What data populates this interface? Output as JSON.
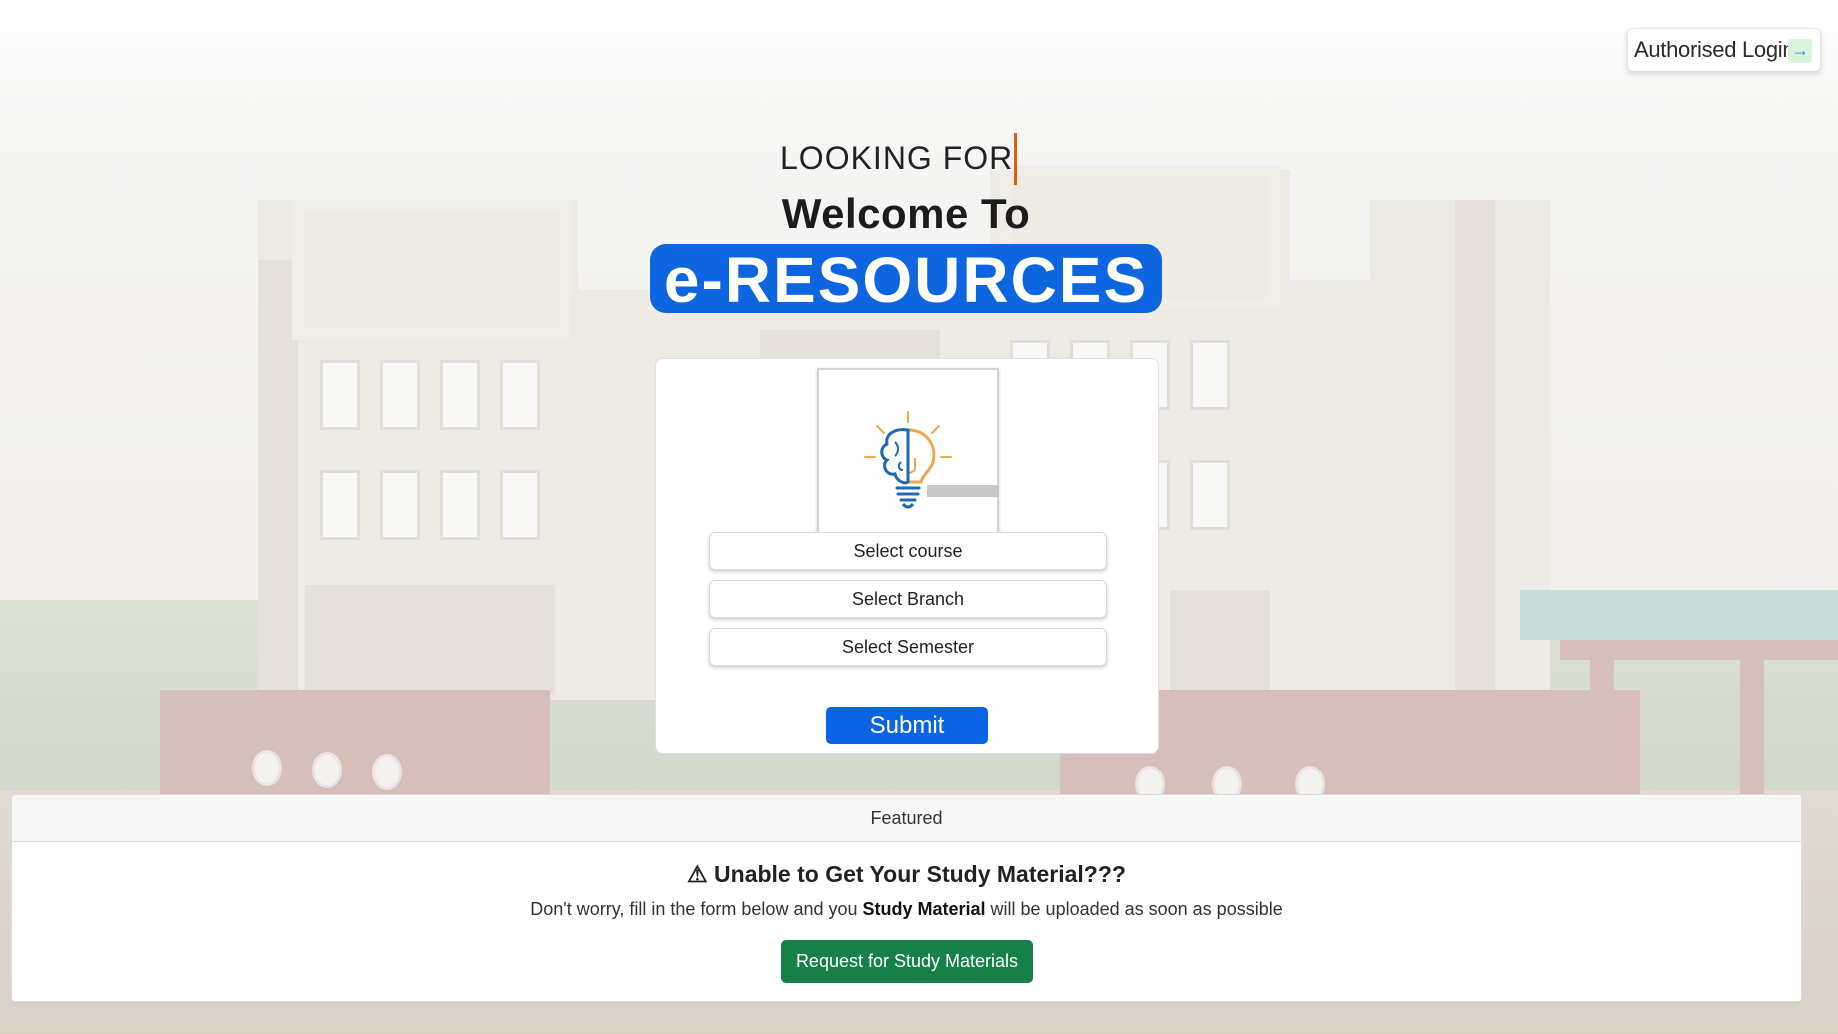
{
  "header": {
    "login_label": "Authorised Login",
    "login_icon": "login-arrow-icon"
  },
  "hero": {
    "looking_for": "LOOKING FOR",
    "welcome": "Welcome To",
    "brand": "e-RESOURCES",
    "brand_color": "#0d66e0"
  },
  "form": {
    "logo_icon": "brain-bulb-logo-icon",
    "course_placeholder": "Select course",
    "branch_placeholder": "Select Branch",
    "semester_placeholder": "Select Semester",
    "submit_label": "Submit",
    "submit_color": "#0a64e6"
  },
  "featured": {
    "header": "Featured",
    "warning_icon": "⚠",
    "title": "Unable to Get Your Study Material???",
    "text_before": "Don't worry, fill in the form below and you ",
    "text_bold": "Study Material",
    "text_after": " will be uploaded as soon as possible",
    "button_label": "Request for Study Materials",
    "button_color": "#178048"
  }
}
